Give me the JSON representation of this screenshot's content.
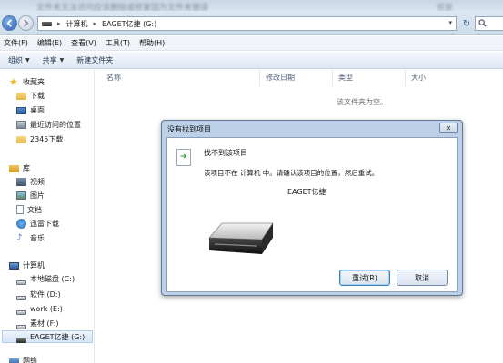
{
  "window": {
    "blurred_title": "文件夹无法访问应该删除或修复因为文件夹错误",
    "blurred_title_right": "修复"
  },
  "address": {
    "crumbs": [
      "计算机",
      "EAGET亿捷 (G:)"
    ],
    "separator": "▸"
  },
  "menu": [
    "文件(F)",
    "编辑(E)",
    "查看(V)",
    "工具(T)",
    "帮助(H)"
  ],
  "toolbar": {
    "organize": "组织",
    "share": "共享",
    "new_folder": "新建文件夹"
  },
  "nav": {
    "favorites": {
      "label": "收藏夹",
      "items": [
        "下载",
        "桌面",
        "最近访问的位置",
        "2345下载"
      ]
    },
    "libraries": {
      "label": "库",
      "items": [
        "视频",
        "图片",
        "文档",
        "迅雷下载",
        "音乐"
      ]
    },
    "computer": {
      "label": "计算机",
      "drives": [
        "本地磁盘 (C:)",
        "软件 (D:)",
        "work (E:)",
        "素材 (F:)",
        "EAGET亿捷 (G:)"
      ]
    },
    "network": {
      "label": "网络"
    }
  },
  "columns": [
    "名称",
    "修改日期",
    "类型",
    "大小"
  ],
  "empty_message": "该文件夹为空。",
  "dialog": {
    "title": "没有找到项目",
    "close": "✕",
    "heading": "找不到该项目",
    "message": "该项目不在 计算机 中。请确认该项目的位置，然后重试。",
    "item_name": "EAGET亿捷",
    "retry": "重试(R)",
    "cancel": "取消"
  },
  "colors": {
    "accent": "#2d62b4",
    "dialog_frame": "#bcd0e7",
    "selection": "#d5e5f7"
  }
}
